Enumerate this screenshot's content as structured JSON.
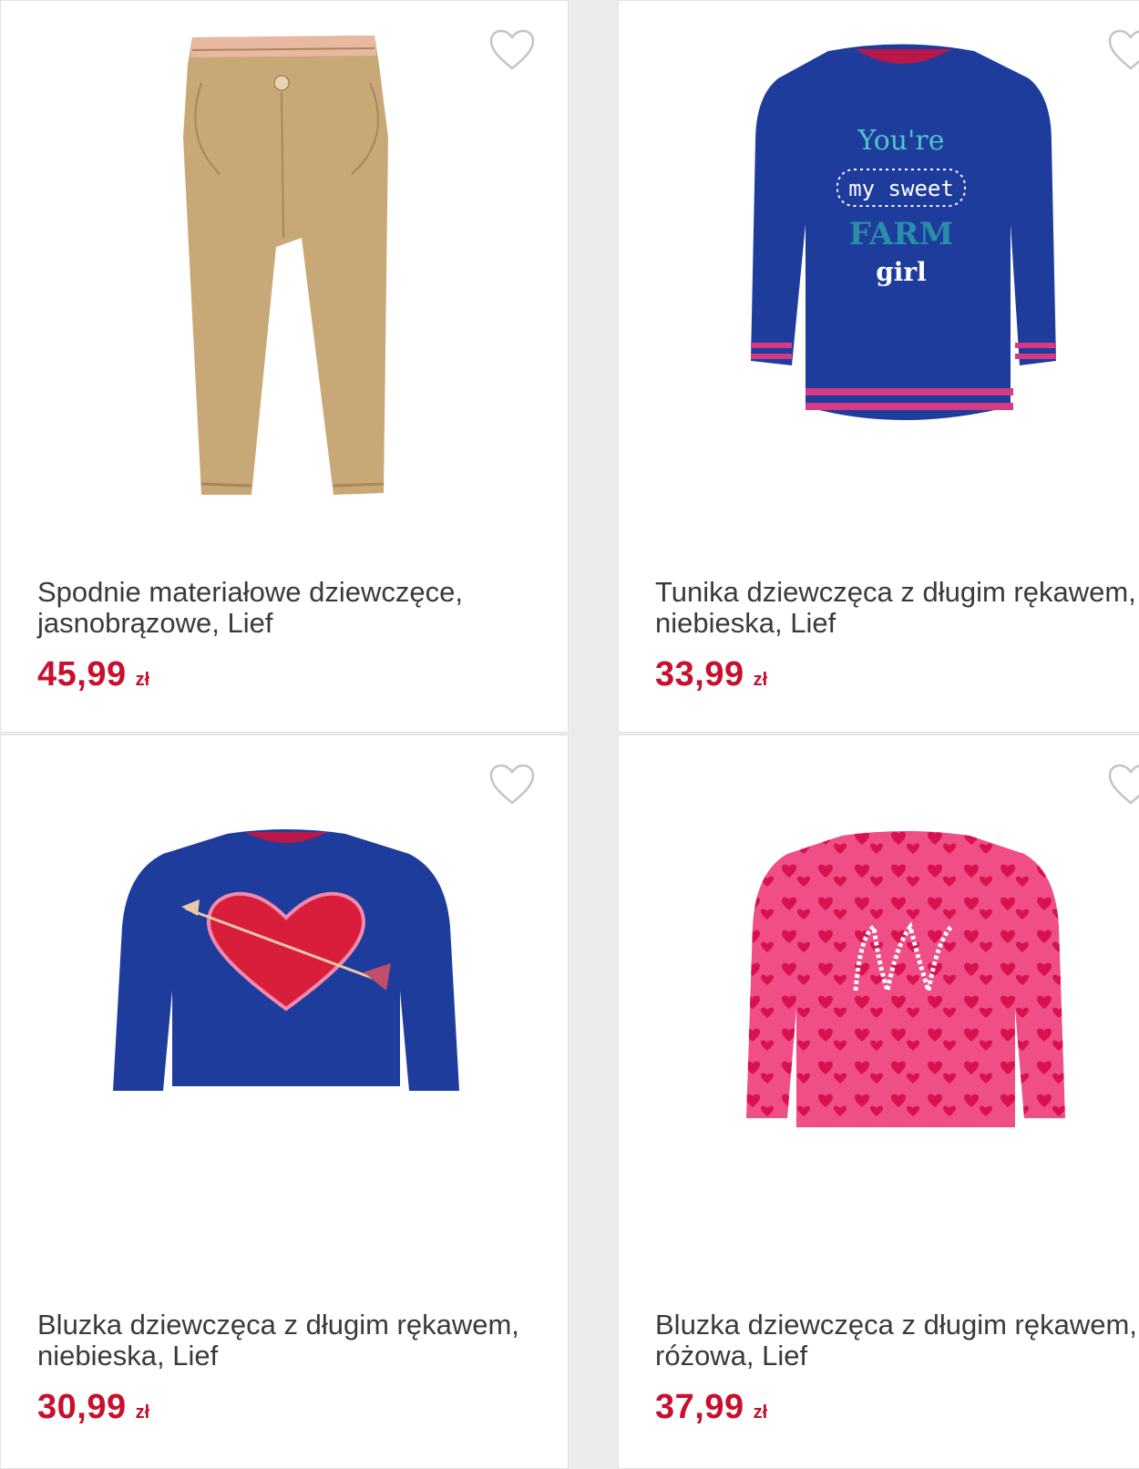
{
  "colors": {
    "price": "#c8102e",
    "title": "#3a3a3a",
    "card_bg": "#ffffff",
    "page_bg": "#ececec"
  },
  "products": [
    {
      "title": "Spodnie materiałowe dziewczęce, jasnobrązowe, Lief",
      "price": "45,99",
      "currency": "zł",
      "favorite_icon": "heart-outline-icon"
    },
    {
      "title": "Tunika dziewczęca z długim rękawem, niebieska, Lief",
      "price": "33,99",
      "currency": "zł",
      "favorite_icon": "heart-outline-icon",
      "print": {
        "line1": "You're",
        "line2": "my sweet",
        "line3": "FARM",
        "line4": "girl"
      }
    },
    {
      "title": "Bluzka dziewczęca z długim rękawem, niebieska, Lief",
      "price": "30,99",
      "currency": "zł",
      "favorite_icon": "heart-outline-icon"
    },
    {
      "title": "Bluzka dziewczęca z długim rękawem, różowa, Lief",
      "price": "37,99",
      "currency": "zł",
      "favorite_icon": "heart-outline-icon"
    }
  ]
}
